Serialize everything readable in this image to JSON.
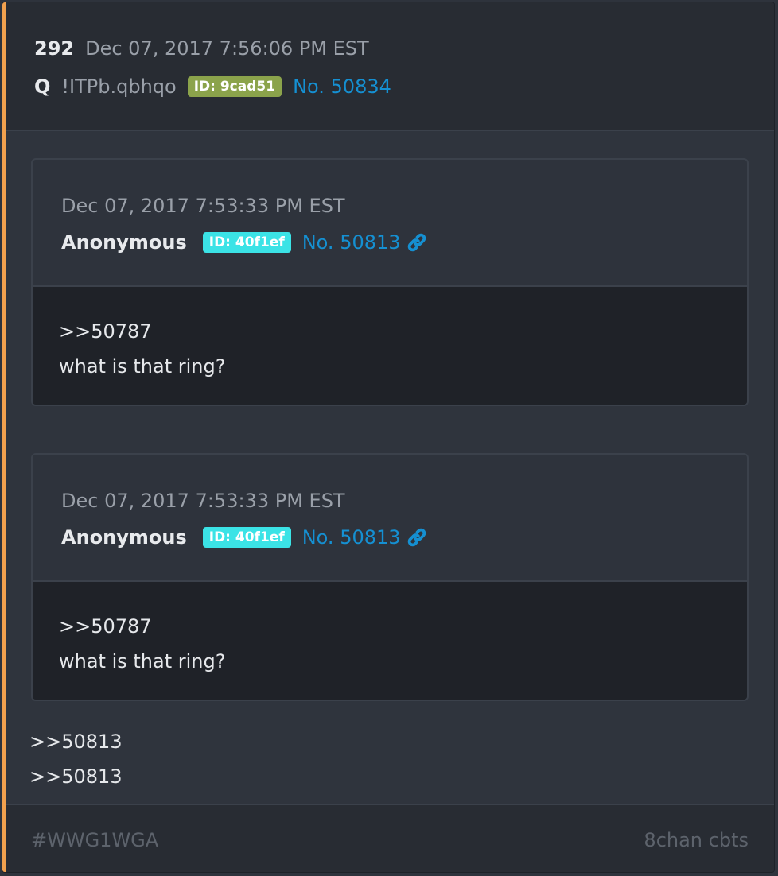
{
  "post": {
    "number": "292",
    "timestamp": "Dec 07, 2017 7:56:06 PM EST",
    "author": "Q",
    "tripcode": "!ITPb.qbhqo",
    "id_badge": "ID: 9cad51",
    "post_link": "No. 50834"
  },
  "quotes": [
    {
      "timestamp": "Dec 07, 2017 7:53:33 PM EST",
      "author": "Anonymous",
      "id_badge": "ID: 40f1ef",
      "post_link": "No. 50813",
      "lines": [
        ">>50787",
        "what is that ring?"
      ]
    },
    {
      "timestamp": "Dec 07, 2017 7:53:33 PM EST",
      "author": "Anonymous",
      "id_badge": "ID: 40f1ef",
      "post_link": "No. 50813",
      "lines": [
        ">>50787",
        "what is that ring?"
      ]
    }
  ],
  "body_lines": [
    ">>50813",
    ">>50813"
  ],
  "footer": {
    "hashtag": "#WWG1WGA",
    "source": "8chan cbts"
  },
  "colors": {
    "accent": "#f2a14e",
    "link": "#1590d2",
    "q_badge": "#8ba34b",
    "anon_badge": "#3be3e6"
  },
  "icons": {
    "quote_link": "link-icon"
  }
}
